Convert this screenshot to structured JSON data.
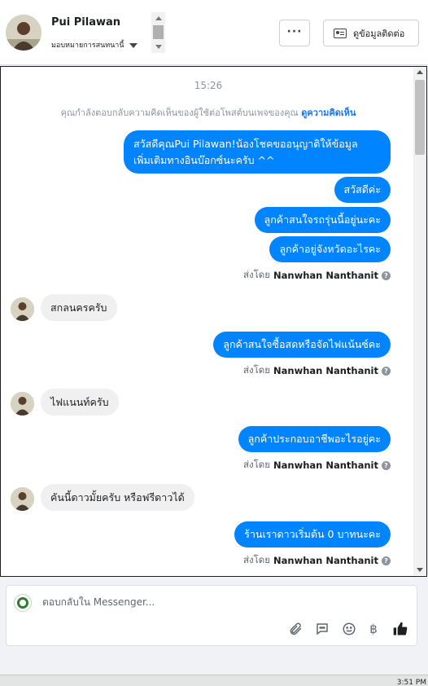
{
  "header": {
    "name": "Pui Pilawan",
    "assign": "มอบหมายการสนทนานี้",
    "more_label": "···",
    "contact_button": "ดูข้อมูลติดต่อ"
  },
  "chat": {
    "time": "15:26",
    "notice_text": "คุณกำลังตอบกลับความคิดเห็นของผู้ใช้ต่อโพสต์บนเพจของคุณ",
    "notice_link": "ดูความคิดเห็น",
    "messages": [
      {
        "text": "สวัสดีคุณPui Pilawan!น้องโชคขออนุญาติให้ข้อมูล"
      },
      {
        "text": "เพิ่มเติมทางอินบ๊อกซ์นะครับ ^^"
      },
      {
        "text": "สวัสดีค่ะ"
      },
      {
        "text": "ลูกค้าสนใจรถรุ่นนี้อยู่นะคะ"
      },
      {
        "text": "ลูกค้าอยู่จังหวัดอะไรคะ"
      },
      {
        "text": "สกลนครครับ"
      },
      {
        "text": "ลูกค้าสนใจซื้อสดหรือจัดไฟแน้นซ์คะ"
      },
      {
        "text": "ไฟแนนท์ครับ"
      },
      {
        "text": "ลูกค้าประกอบอาชีพอะไรอยู่คะ"
      },
      {
        "text": "คันนี้ดาวมั้ยครับ หรือฟรีดาวได้"
      },
      {
        "text": "ร้านเราดาวเริ่มต้น 0 บาทนะคะ"
      }
    ],
    "sent_by_label": "ส่งโดย",
    "sender": "Nanwhan Nanthanit",
    "help_glyph": "?"
  },
  "composer": {
    "placeholder": "ตอบกลับใน Messenger...",
    "icons": [
      "paperclip-icon",
      "chat-bubble-icon",
      "smiley-icon",
      "baht-icon",
      "thumbs-up-icon"
    ],
    "baht_glyph": "฿"
  },
  "footer": {
    "clock": "3:51 PM"
  }
}
